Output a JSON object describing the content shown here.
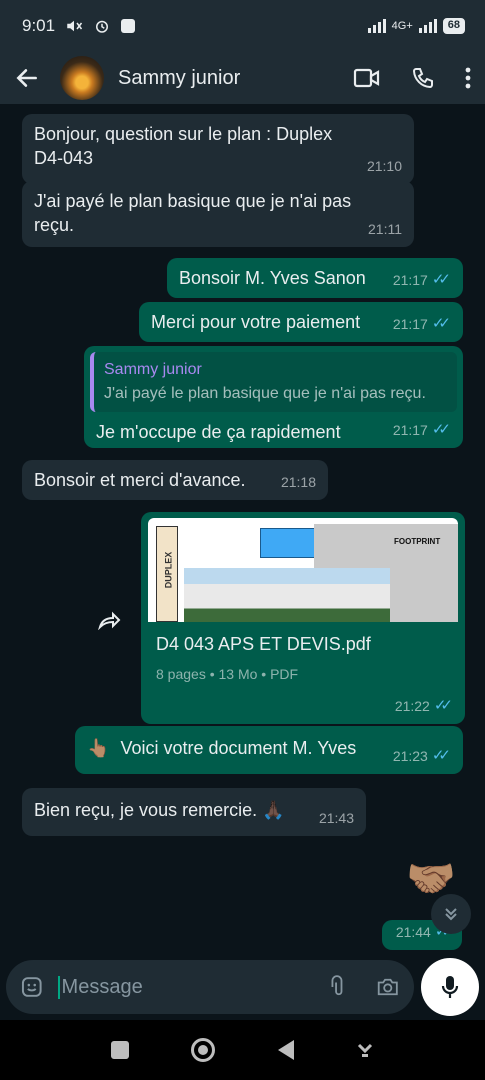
{
  "status_bar": {
    "time": "9:01",
    "network": "4G+",
    "battery": "68"
  },
  "header": {
    "contact_name": "Sammy junior"
  },
  "messages": [
    {
      "dir": "in",
      "text": "Bonjour, question sur le plan : Duplex D4-043",
      "time": "21:10"
    },
    {
      "dir": "in",
      "text": "J'ai payé le plan basique que je n'ai pas reçu.",
      "time": "21:11"
    },
    {
      "dir": "out",
      "text": "Bonsoir M. Yves Sanon",
      "time": "21:17"
    },
    {
      "dir": "out",
      "text": "Merci pour votre paiement",
      "time": "21:17"
    },
    {
      "dir": "out",
      "quote_name": "Sammy junior",
      "quote_text": "J'ai payé le plan basique que je n'ai pas reçu.",
      "text": "Je m'occupe de ça rapidement",
      "time": "21:17"
    },
    {
      "dir": "in",
      "text": "Bonsoir et merci d'avance.",
      "time": "21:18"
    },
    {
      "dir": "out",
      "doc_title": "D4 043 APS ET DEVIS.pdf",
      "doc_meta": "8 pages • 13 Mo • PDF",
      "thumb_label": "FOOTPRINT",
      "thumb_side": "DUPLEX",
      "time": "21:22"
    },
    {
      "dir": "out",
      "emoji": "👆🏽",
      "text": "Voici votre document M. Yves",
      "time": "21:23"
    },
    {
      "dir": "in",
      "text": "Bien reçu, je vous remercie.",
      "emoji": "🙏🏿",
      "time": "21:43"
    },
    {
      "dir": "out",
      "emoji": "🤝🏽",
      "time": "21:44"
    }
  ],
  "composer": {
    "placeholder": "Message"
  },
  "colors": {
    "incoming": "#1f2c34",
    "outgoing": "#005c4b",
    "accent": "#00a884",
    "read_ticks": "#53bdeb"
  }
}
